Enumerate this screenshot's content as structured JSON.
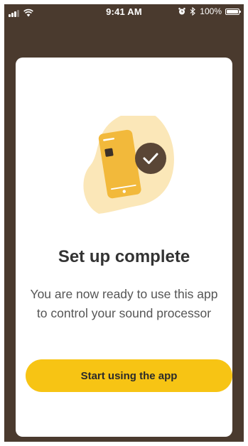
{
  "status_bar": {
    "time": "9:41 AM",
    "battery_text": "100%",
    "battery_level": 1.0,
    "icons": [
      "signal-icon",
      "wifi-icon",
      "alarm-icon",
      "bluetooth-icon",
      "battery-icon"
    ]
  },
  "colors": {
    "background": "#4a3a2e",
    "card": "#ffffff",
    "accent": "#f7c414",
    "illustration_blob": "#fbe7b8",
    "phone_body": "#f2b93b",
    "check_badge": "#5a4636",
    "title_text": "#333333",
    "body_text": "#555555"
  },
  "content": {
    "illustration_icon": "phone-with-checkmark-illustration",
    "title": "Set up complete",
    "message": "You are now ready to use this app to control your sound processor",
    "button_label": "Start using the app"
  }
}
